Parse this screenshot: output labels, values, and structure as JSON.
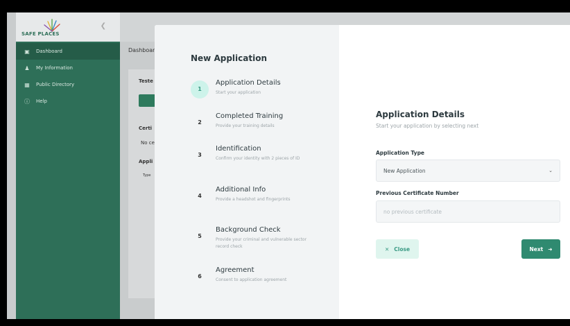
{
  "brand": {
    "logo_text": "SAFE PLACES"
  },
  "sidebar": {
    "items": [
      {
        "label": "Dashboard",
        "icon": "monitor-icon"
      },
      {
        "label": "My Information",
        "icon": "person-icon"
      },
      {
        "label": "Public Directory",
        "icon": "book-icon"
      },
      {
        "label": "Help",
        "icon": "help-circle-icon"
      }
    ]
  },
  "background": {
    "breadcrumb": "Dashboar",
    "snippets": [
      "Teste",
      "Certi",
      "No ce",
      "Appli",
      "Type"
    ]
  },
  "modal": {
    "title": "New Application",
    "steps": [
      {
        "number": "1",
        "title": "Application Details",
        "desc": "Start your application"
      },
      {
        "number": "2",
        "title": "Completed Training",
        "desc": "Provide your training details"
      },
      {
        "number": "3",
        "title": "Identification",
        "desc": "Confirm your identity with 2 pieces of ID"
      },
      {
        "number": "4",
        "title": "Additional Info",
        "desc": "Provide a headshot and fingerprints"
      },
      {
        "number": "5",
        "title": "Background Check",
        "desc": "Provide your criminal and vulnerable sector record check"
      },
      {
        "number": "6",
        "title": "Agreement",
        "desc": "Consent to application agreement"
      }
    ],
    "form": {
      "title": "Application Details",
      "subtitle": "Start your application by selecting next",
      "application_type_label": "Application Type",
      "application_type_value": "New Application",
      "prev_cert_label": "Previous Certificate Number",
      "prev_cert_placeholder": "no previous certificate",
      "close_label": "Close",
      "next_label": "Next"
    }
  },
  "colors": {
    "sidebar": "#2e6f58",
    "accent": "#2f8a70",
    "active_step": "#cdf3ea"
  }
}
